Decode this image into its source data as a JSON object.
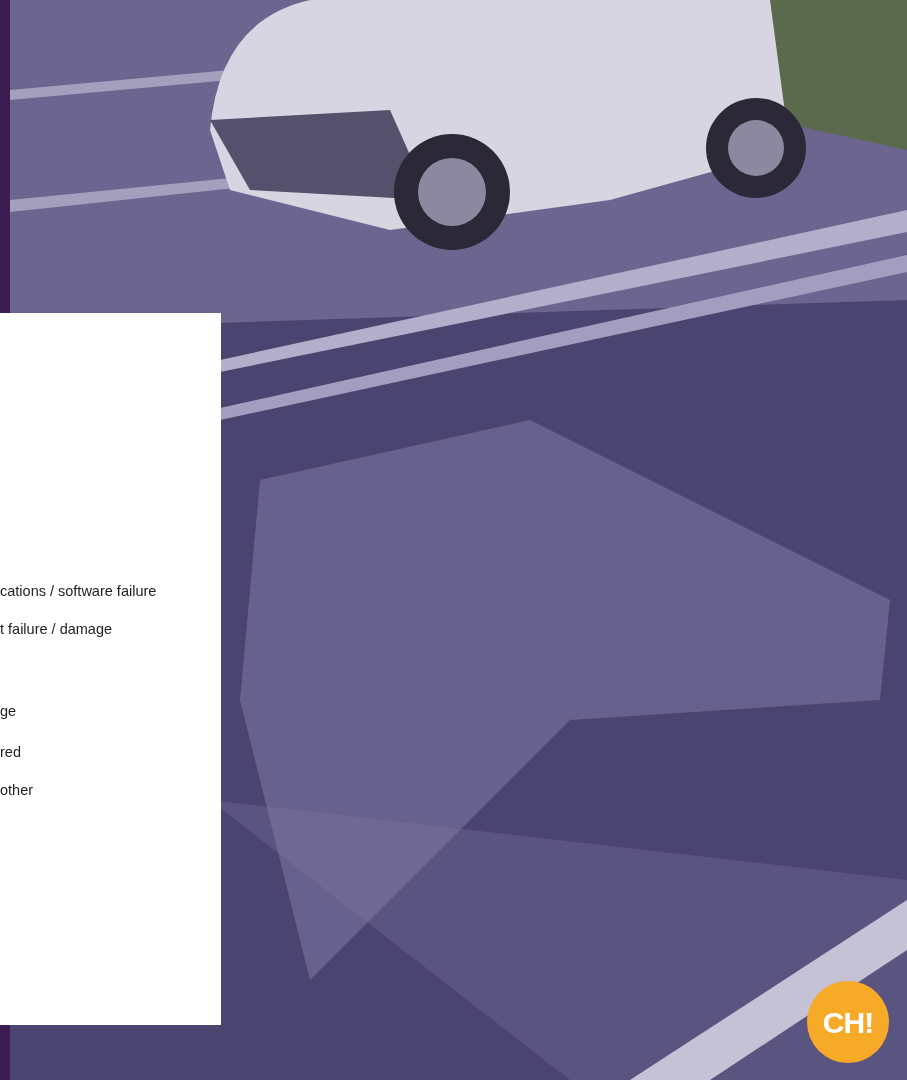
{
  "card": {
    "options": [
      {
        "label": "cations / software failure"
      },
      {
        "label": "t failure / damage"
      },
      {
        "label": "ge"
      },
      {
        "label": "red"
      },
      {
        "label": "other"
      }
    ]
  },
  "chat_launcher": {
    "label": "CH!"
  }
}
